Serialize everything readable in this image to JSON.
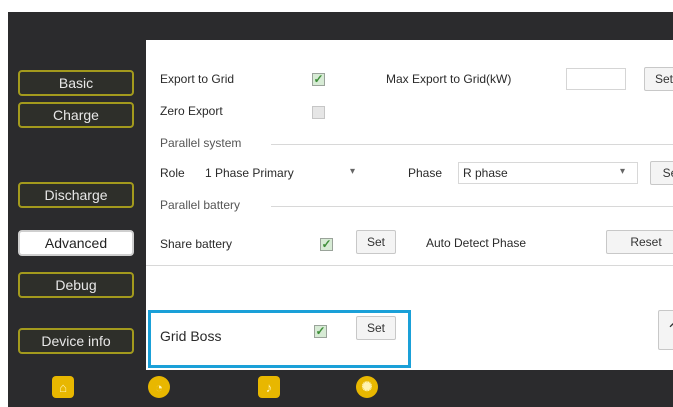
{
  "sidebar": {
    "items": [
      {
        "label": "Basic"
      },
      {
        "label": "Charge"
      },
      {
        "label": "Discharge"
      },
      {
        "label": "Advanced",
        "active": true
      },
      {
        "label": "Debug"
      },
      {
        "label": "Device info"
      }
    ]
  },
  "export": {
    "export_to_grid_label": "Export to Grid",
    "export_to_grid_checked": true,
    "max_export_label": "Max Export to Grid(kW)",
    "max_export_value": "",
    "set_label": "Set",
    "zero_export_label": "Zero Export",
    "zero_export_checked": false
  },
  "parallel_system": {
    "title": "Parallel system",
    "role_label": "Role",
    "role_value": "1 Phase Primary",
    "phase_label": "Phase",
    "phase_value": "R phase",
    "set_label": "Se"
  },
  "parallel_battery": {
    "title": "Parallel battery",
    "share_battery_label": "Share battery",
    "share_battery_checked": true,
    "set_label": "Set",
    "auto_detect_label": "Auto Detect Phase",
    "reset_label": "Reset"
  },
  "grid_boss": {
    "label": "Grid Boss",
    "checked": true,
    "set_label": "Set"
  },
  "bottom_nav": {
    "icons": [
      "home-icon",
      "chart-icon",
      "alarm-bell-icon",
      "settings-gear-icon"
    ]
  },
  "colors": {
    "highlight": "#1aa0d8",
    "nav_border": "#a39a1d",
    "bottom_icon": "#e8b700"
  }
}
